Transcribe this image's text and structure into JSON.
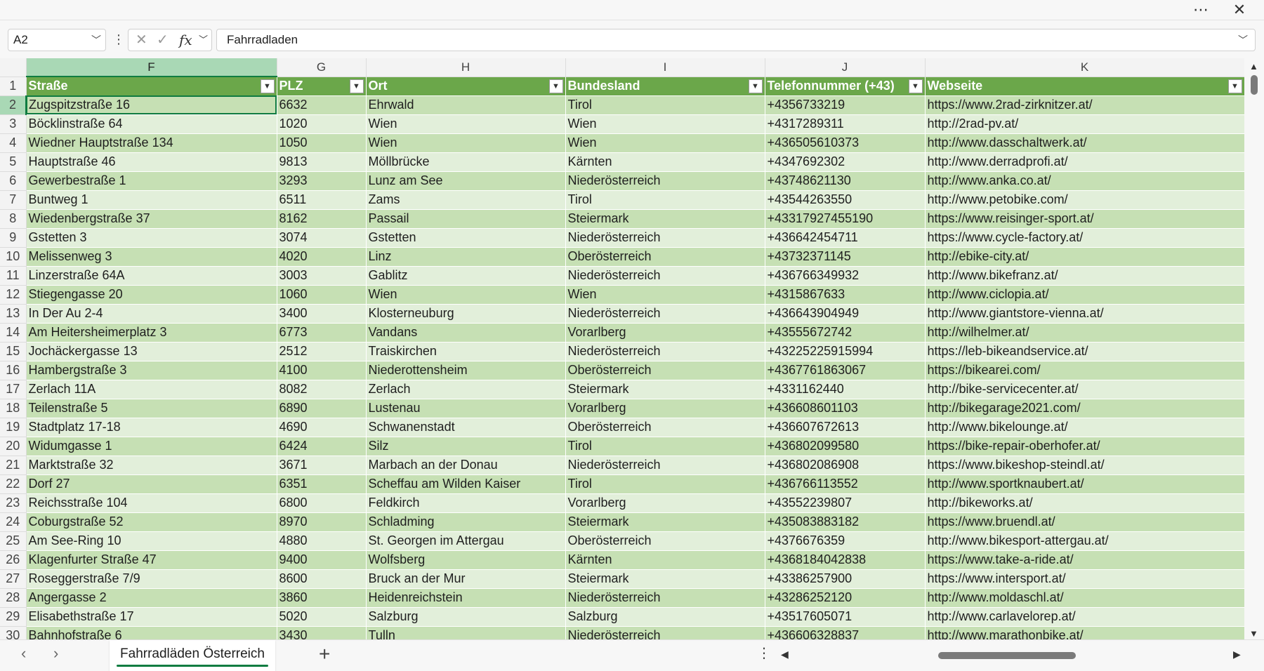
{
  "window": {
    "more_icon": "ellipsis",
    "close_icon": "close"
  },
  "formula_bar": {
    "name_box": "A2",
    "fx_label": "fx",
    "content": "Fahrradladen"
  },
  "columns": [
    "F",
    "G",
    "H",
    "I",
    "J",
    "K"
  ],
  "selected_column": "F",
  "header_row_number": "1",
  "headers": [
    "Straße",
    "PLZ",
    "Ort",
    "Bundesland",
    "Telefonnummer (+43)",
    "Webseite"
  ],
  "rows": [
    {
      "n": "2",
      "c": [
        "Zugspitzstraße 16",
        "6632",
        "Ehrwald",
        "Tirol",
        "+4356733219",
        "https://www.2rad-zirknitzer.at/"
      ]
    },
    {
      "n": "3",
      "c": [
        "Böcklinstraße 64",
        "1020",
        "Wien",
        "Wien",
        "+4317289311",
        "http://2rad-pv.at/"
      ]
    },
    {
      "n": "4",
      "c": [
        "Wiedner Hauptstraße 134",
        "1050",
        "Wien",
        "Wien",
        "+436505610373",
        "http://www.dasschaltwerk.at/"
      ]
    },
    {
      "n": "5",
      "c": [
        "Hauptstraße 46",
        "9813",
        "Möllbrücke",
        "Kärnten",
        "+4347692302",
        "http://www.derradprofi.at/"
      ]
    },
    {
      "n": "6",
      "c": [
        "Gewerbestraße 1",
        "3293",
        "Lunz am See",
        "Niederösterreich",
        "+43748621130",
        "http://www.anka.co.at/"
      ]
    },
    {
      "n": "7",
      "c": [
        "Buntweg 1",
        "6511",
        "Zams",
        "Tirol",
        "+43544263550",
        "http://www.petobike.com/"
      ]
    },
    {
      "n": "8",
      "c": [
        "Wiedenbergstraße 37",
        "8162",
        "Passail",
        "Steiermark",
        "+43317927455190",
        "https://www.reisinger-sport.at/"
      ]
    },
    {
      "n": "9",
      "c": [
        "Gstetten 3",
        "3074",
        "Gstetten",
        "Niederösterreich",
        "+436642454711",
        "https://www.cycle-factory.at/"
      ]
    },
    {
      "n": "10",
      "c": [
        "Melissenweg 3",
        "4020",
        "Linz",
        "Oberösterreich",
        "+43732371145",
        "http://ebike-city.at/"
      ]
    },
    {
      "n": "11",
      "c": [
        "Linzerstraße 64A",
        "3003",
        "Gablitz",
        "Niederösterreich",
        "+436766349932",
        "http://www.bikefranz.at/"
      ]
    },
    {
      "n": "12",
      "c": [
        "Stiegengasse 20",
        "1060",
        "Wien",
        "Wien",
        "+4315867633",
        "http://www.ciclopia.at/"
      ]
    },
    {
      "n": "13",
      "c": [
        "In Der Au 2-4",
        "3400",
        "Klosterneuburg",
        "Niederösterreich",
        "+436643904949",
        "http://www.giantstore-vienna.at/"
      ]
    },
    {
      "n": "14",
      "c": [
        "Am Heitersheimerplatz 3",
        "6773",
        "Vandans",
        "Vorarlberg",
        "+43555672742",
        "http://wilhelmer.at/"
      ]
    },
    {
      "n": "15",
      "c": [
        "Jochäckergasse 13",
        "2512",
        "Traiskirchen",
        "Niederösterreich",
        "+43225225915994",
        "https://leb-bikeandservice.at/"
      ]
    },
    {
      "n": "16",
      "c": [
        "Hambergstraße 3",
        "4100",
        "Niederottensheim",
        "Oberösterreich",
        "+4367761863067",
        "https://bikearei.com/"
      ]
    },
    {
      "n": "17",
      "c": [
        "Zerlach 11A",
        "8082",
        "Zerlach",
        "Steiermark",
        "+4331162440",
        "http://bike-servicecenter.at/"
      ]
    },
    {
      "n": "18",
      "c": [
        "Teilenstraße 5",
        "6890",
        "Lustenau",
        "Vorarlberg",
        "+436608601103",
        "http://bikegarage2021.com/"
      ]
    },
    {
      "n": "19",
      "c": [
        "Stadtplatz 17-18",
        "4690",
        "Schwanenstadt",
        "Oberösterreich",
        "+436607672613",
        "http://www.bikelounge.at/"
      ]
    },
    {
      "n": "20",
      "c": [
        "Widumgasse 1",
        "6424",
        "Silz",
        "Tirol",
        "+436802099580",
        "https://bike-repair-oberhofer.at/"
      ]
    },
    {
      "n": "21",
      "c": [
        "Marktstraße 32",
        "3671",
        "Marbach an der Donau",
        "Niederösterreich",
        "+436802086908",
        "https://www.bikeshop-steindl.at/"
      ]
    },
    {
      "n": "22",
      "c": [
        "Dorf 27",
        "6351",
        "Scheffau am Wilden Kaiser",
        "Tirol",
        "+436766113552",
        "http://www.sportknaubert.at/"
      ]
    },
    {
      "n": "23",
      "c": [
        "Reichsstraße 104",
        "6800",
        "Feldkirch",
        "Vorarlberg",
        "+43552239807",
        "http://bikeworks.at/"
      ]
    },
    {
      "n": "24",
      "c": [
        "Coburgstraße 52",
        "8970",
        "Schladming",
        "Steiermark",
        "+435083883182",
        "https://www.bruendl.at/"
      ]
    },
    {
      "n": "25",
      "c": [
        "Am See-Ring 10",
        "4880",
        "St. Georgen im Attergau",
        "Oberösterreich",
        "+4376676359",
        "http://www.bikesport-attergau.at/"
      ]
    },
    {
      "n": "26",
      "c": [
        "Klagenfurter Straße 47",
        "9400",
        "Wolfsberg",
        "Kärnten",
        "+4368184042838",
        "https://www.take-a-ride.at/"
      ]
    },
    {
      "n": "27",
      "c": [
        "Roseggerstraße 7/9",
        "8600",
        "Bruck an der Mur",
        "Steiermark",
        "+43386257900",
        "https://www.intersport.at/"
      ]
    },
    {
      "n": "28",
      "c": [
        "Angergasse 2",
        "3860",
        "Heidenreichstein",
        "Niederösterreich",
        "+43286252120",
        "http://www.moldaschl.at/"
      ]
    },
    {
      "n": "29",
      "c": [
        "Elisabethstraße 17",
        "5020",
        "Salzburg",
        "Salzburg",
        "+43517605071",
        "http://www.carlavelorep.at/"
      ]
    },
    {
      "n": "30",
      "c": [
        "Bahnhofstraße 6",
        "3430",
        "Tulln",
        "Niederösterreich",
        "+436606328837",
        "http://www.marathonbike.at/"
      ]
    }
  ],
  "sheet_tab": "Fahrradläden Österreich",
  "colors": {
    "header_green": "#6ba74a",
    "band_dark": "#c6e0b4",
    "band_light": "#e2efda",
    "accent": "#107c41"
  }
}
